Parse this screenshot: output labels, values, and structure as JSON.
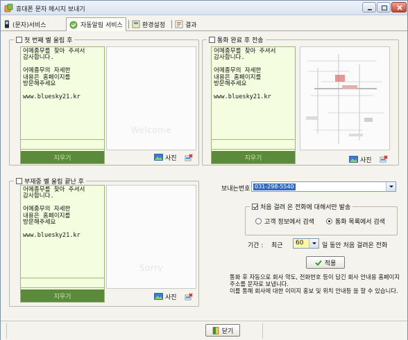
{
  "window": {
    "title": "휴대폰 문자 메시지 보내기"
  },
  "tabs": [
    {
      "label": "(문자)서비스"
    },
    {
      "label": "자동알림 서비스"
    },
    {
      "label": "환경설정"
    },
    {
      "label": "결과"
    }
  ],
  "panels": {
    "first_ring": {
      "title": "첫 번째 벨 울림 후",
      "message": "어메종무를 찾아 주셔서\n감사합니다.\n\n어메종무의 자세한\n내용은 홈페이지를\n방문해주세요\n\nwww.bluesky21.kr",
      "clear_label": "지우기",
      "image_placeholder": "Welcome",
      "photo_label": "사진"
    },
    "after_call": {
      "title": "통화 완료 후 전송",
      "message": "어메종무를 찾아 주셔서\n감사합니다.\n\n어메종무의 자세한\n내용은 홈페이지를\n방문해주세요\n\nwww.bluesky21.kr",
      "clear_label": "지우기",
      "photo_label": "사진"
    },
    "missed_call": {
      "title": "부재중 벨 울림 끝난 후",
      "message": "어메종무를 찾아 주셔서\n감사합니다.\n\n어메종무의 자세한\n내용은 홈페이지를\n방문해주세요\n\nwww.bluesky21.kr",
      "clear_label": "지우기",
      "image_placeholder": "Sorry",
      "photo_label": "사진"
    }
  },
  "settings": {
    "sender_label": "보내는번호",
    "sender_number": "031-298-5540",
    "first_call_only_label": "처음 걸려 온 전화에 대해서만 발송",
    "search_customer_label": "고객 정보에서 검색",
    "search_call_log_label": "통화 목록에서 검색",
    "period_label": "기간 :",
    "period_prefix": "최근",
    "period_days": "60",
    "period_suffix": "일 동안 처음 걸려온 전화",
    "apply_label": "적용",
    "description": "통화 후 자동으로 회사 약도, 전화번호 등이 담긴 회사 안내용 홈페이지 주소를 문자로 보냅니다.\n이를 통해 회사에 대한 이미지 홍보 및 위치 안내등 을 할 수 있습니다."
  },
  "footer": {
    "close_label": "닫기"
  },
  "colors": {
    "message_bg": "#f5fde0",
    "clear_bar": "#5a8a3a",
    "selection": "#316ac5",
    "apply_check": "#2f9a2f"
  }
}
